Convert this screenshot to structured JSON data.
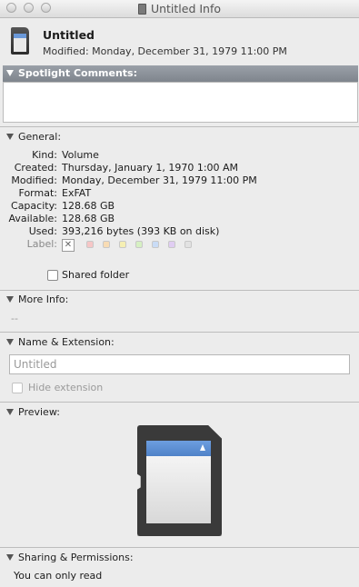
{
  "window": {
    "title": "Untitled Info"
  },
  "header": {
    "name": "Untitled",
    "modified": "Modified: Monday, December 31, 1979 11:00 PM"
  },
  "spotlight": {
    "label": "Spotlight Comments:"
  },
  "general": {
    "label": "General:",
    "rows": [
      {
        "k": "Kind:",
        "v": "Volume"
      },
      {
        "k": "Created:",
        "v": "Thursday, January 1, 1970 1:00 AM"
      },
      {
        "k": "Modified:",
        "v": "Monday, December 31, 1979 11:00 PM"
      },
      {
        "k": "Format:",
        "v": "ExFAT"
      },
      {
        "k": "Capacity:",
        "v": "128.68 GB"
      },
      {
        "k": "Available:",
        "v": "128.68 GB"
      },
      {
        "k": "Used:",
        "v": "393,216 bytes (393 KB on disk)"
      }
    ],
    "label_key": "Label:",
    "label_colors": [
      "#f6c6c6",
      "#f8dcb4",
      "#f5efb3",
      "#d6f0c2",
      "#c9dcf6",
      "#e0cdf2",
      "#e2e2e2"
    ],
    "shared_folder": "Shared folder"
  },
  "more_info": {
    "label": "More Info:",
    "value": "--"
  },
  "name_ext": {
    "label": "Name & Extension:",
    "name_value": "Untitled",
    "hide_extension": "Hide extension"
  },
  "preview": {
    "label": "Preview:"
  },
  "sharing": {
    "label": "Sharing & Permissions:",
    "value": "You can only read"
  }
}
